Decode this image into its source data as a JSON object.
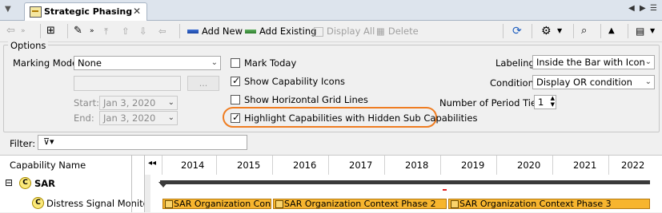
{
  "tab": {
    "title": "Strategic Phasing",
    "close": "✕"
  },
  "nav": {
    "left": "◀",
    "right": "▶",
    "menu": "☰"
  },
  "toolbar": {
    "add_new": "Add New",
    "add_existing": "Add Existing",
    "display_all": "Display All",
    "delete": "Delete"
  },
  "options": {
    "legend": "Options",
    "marking_mode_label": "Marking Mode:",
    "marking_mode_value": "None",
    "ellipsis": "...",
    "start_label": "Start:",
    "start_value": "Jan 3, 2020",
    "end_label": "End:",
    "end_value": "Jan 3, 2020",
    "mark_today": "Mark Today",
    "show_capability_icons": "Show Capability Icons",
    "show_horizontal_grid_lines": "Show Horizontal Grid Lines",
    "highlight_hidden": "Highlight Capabilities with Hidden Sub Capabilities",
    "labeling_label": "Labeling:",
    "labeling_value": "Inside the Bar with Icon",
    "condition_label": "Condition:",
    "condition_value": "Display OR condition",
    "period_tiers_label": "Number of Period Tiers:",
    "period_tiers_value": "1"
  },
  "filter": {
    "label": "Filter:"
  },
  "grid": {
    "capability_header": "Capability Name",
    "years": [
      "2014",
      "2015",
      "2016",
      "2017",
      "2018",
      "2019",
      "2020",
      "2021",
      "2022"
    ],
    "rows": [
      {
        "name": "SAR",
        "expander": "⊟"
      },
      {
        "name": "Distress Signal Monito"
      }
    ],
    "bars": [
      {
        "label": "SAR Organization Con..."
      },
      {
        "label": "SAR Organization Context Phase 2"
      },
      {
        "label": "SAR Organization Context Phase 3"
      }
    ]
  }
}
